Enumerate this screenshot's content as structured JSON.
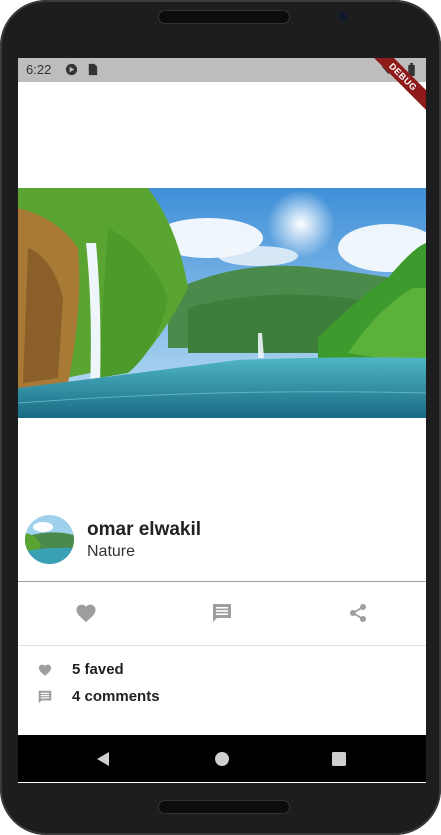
{
  "status_bar": {
    "time": "6:22",
    "ribbon_label": "DEBUG",
    "icons": [
      "play-protect-icon",
      "sd-card-icon",
      "wifi-icon",
      "battery-icon"
    ]
  },
  "post": {
    "author_name": "omar elwakil",
    "category": "Nature"
  },
  "actions": [
    {
      "icon": "heart-icon"
    },
    {
      "icon": "comment-icon"
    },
    {
      "icon": "share-icon"
    }
  ],
  "stats": {
    "faves": "5 faved",
    "comments": "4 comments"
  },
  "nav": {
    "icons": [
      "back-icon",
      "home-icon",
      "recents-icon"
    ]
  },
  "colors": {
    "icon_gray": "#9e9e9e",
    "status_bar": "#bdbdbd",
    "ribbon": "#8e1a1a"
  }
}
